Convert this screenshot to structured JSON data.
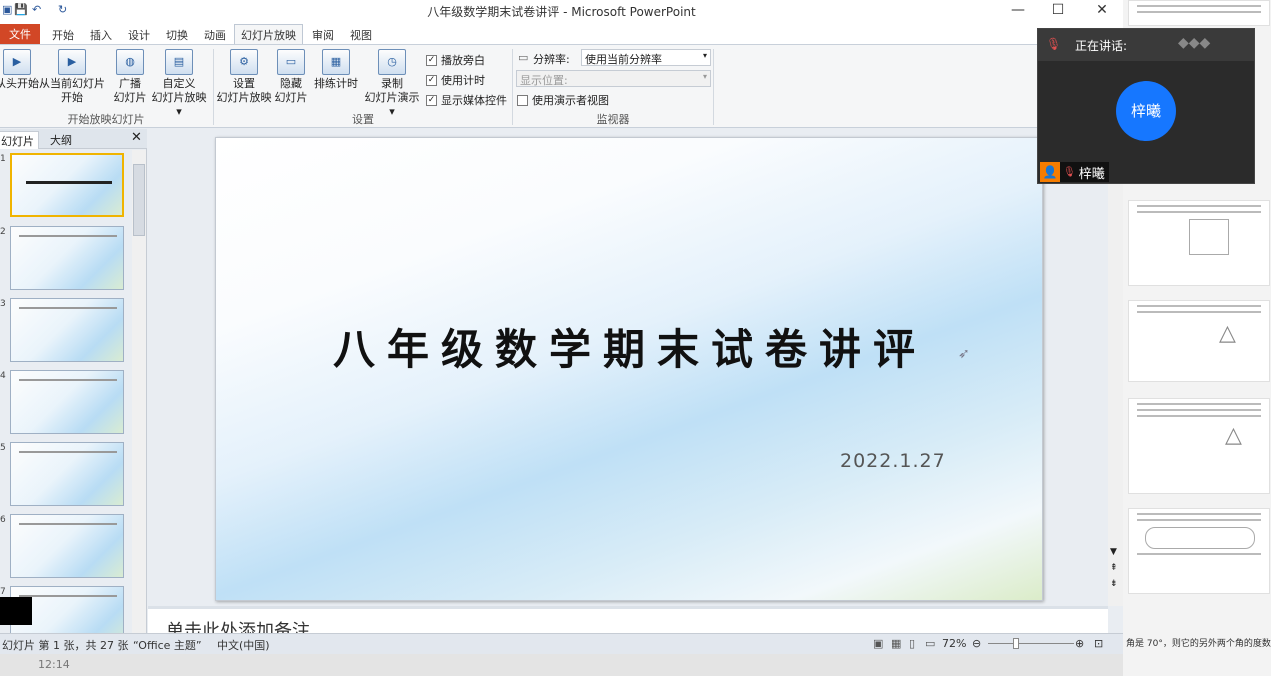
{
  "window": {
    "title": "八年级数学期末试卷讲评 - Microsoft PowerPoint",
    "minimize": "—",
    "maximize": "☐",
    "close": "✕"
  },
  "tabs": [
    {
      "label": "文件"
    },
    {
      "label": "开始"
    },
    {
      "label": "插入"
    },
    {
      "label": "设计"
    },
    {
      "label": "切换"
    },
    {
      "label": "动画"
    },
    {
      "label": "幻灯片放映"
    },
    {
      "label": "审阅"
    },
    {
      "label": "视图"
    }
  ],
  "ribbon": {
    "start_group": {
      "label": "开始放映幻灯片",
      "from_start": "从头开始",
      "from_current_1": "从当前幻灯片",
      "from_current_2": "开始",
      "broadcast_1": "广播",
      "broadcast_2": "幻灯片",
      "custom_1": "自定义",
      "custom_2": "幻灯片放映"
    },
    "setup_group": {
      "label": "设置",
      "setup_1": "设置",
      "setup_2": "幻灯片放映",
      "hide_1": "隐藏",
      "hide_2": "幻灯片",
      "rehearse": "排练计时",
      "record_1": "录制",
      "record_2": "幻灯片演示",
      "cb_narration": "播放旁白",
      "cb_timing": "使用计时",
      "cb_media": "显示媒体控件"
    },
    "monitor_group": {
      "label": "监视器",
      "resolution_label": "分辨率:",
      "resolution_value": "使用当前分辨率",
      "show_on_label": "显示位置:",
      "presenter_view": "使用演示者视图"
    }
  },
  "panel": {
    "tab_slides": "幻灯片",
    "tab_outline": "大纲",
    "close": "✕",
    "slide_numbers": [
      "1",
      "2",
      "3",
      "4",
      "5",
      "6",
      "7"
    ]
  },
  "slide": {
    "title": "八年级数学期末试卷讲评",
    "date": "2022.1.27"
  },
  "notes": {
    "placeholder": "单击此处添加备注"
  },
  "status": {
    "slide_info": "幻灯片 第 1 张，共 27 张",
    "theme": "“Office 主题”",
    "language": "中文(中国)",
    "zoom": "72%"
  },
  "meeting": {
    "speaking_label": "正在讲话:",
    "participant": "梓曦"
  },
  "taskbar": {
    "time": "12:14"
  },
  "right_doc": {
    "bottom_text": "角是 70°，则它的另外两个角的度数"
  }
}
